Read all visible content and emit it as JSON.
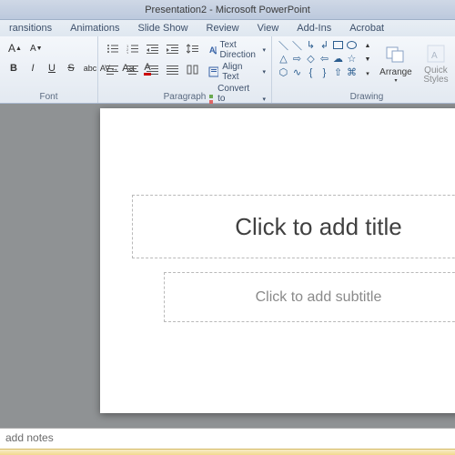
{
  "title": "Presentation2 - Microsoft PowerPoint",
  "tabs": [
    "ransitions",
    "Animations",
    "Slide Show",
    "Review",
    "View",
    "Add-Ins",
    "Acrobat"
  ],
  "ribbon": {
    "font": {
      "label": "Font",
      "bold": "B",
      "italic": "I",
      "underline": "U",
      "strike": "S",
      "shadow": "abc",
      "spacing": "AV",
      "case": "Aa",
      "fontcolor": "A"
    },
    "paragraph": {
      "label": "Paragraph",
      "text_direction": "Text Direction",
      "align_text": "Align Text",
      "smartart": "Convert to SmartArt"
    },
    "drawing": {
      "label": "Drawing",
      "arrange": "Arrange",
      "quick_styles": "Quick\nStyles"
    }
  },
  "slide": {
    "title_placeholder": "Click to add title",
    "subtitle_placeholder": "Click to add subtitle"
  },
  "notes_placeholder": " add notes"
}
